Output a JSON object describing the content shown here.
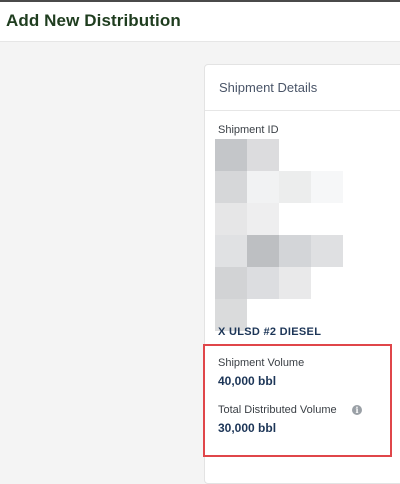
{
  "page": {
    "title": "Add New Distribution"
  },
  "card": {
    "title": "Shipment Details",
    "shipment_id_label": "Shipment ID",
    "product_line": "X ULSD #2 DIESEL",
    "shipment_volume_label": "Shipment Volume",
    "shipment_volume_value": "40,000 bbl",
    "total_distributed_label": "Total Distributed Volume",
    "total_distributed_value": "30,000 bbl",
    "info_icon": "info-icon"
  },
  "colors": {
    "title_green": "#1f3d1f",
    "value_navy": "#1c3557",
    "highlight_red": "#e0464a"
  }
}
